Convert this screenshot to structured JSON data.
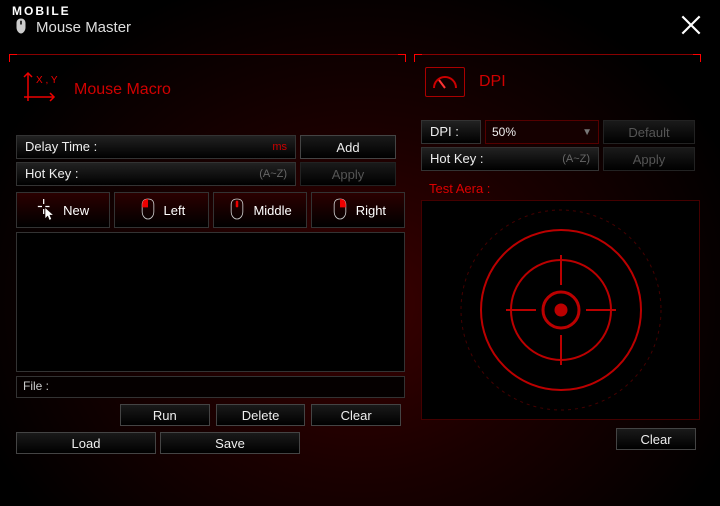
{
  "header": {
    "brand": "MOBILE",
    "title": "Mouse Master"
  },
  "macro": {
    "title": "Mouse Macro",
    "delay_label": "Delay Time :",
    "delay_unit": "ms",
    "add_label": "Add",
    "hotkey_label": "Hot Key :",
    "hotkey_hint": "(A~Z)",
    "apply_label": "Apply",
    "tabs": {
      "new": "New",
      "left": "Left",
      "middle": "Middle",
      "right": "Right"
    },
    "file_label": "File :",
    "run_label": "Run",
    "delete_label": "Delete",
    "clear_label": "Clear",
    "load_label": "Load",
    "save_label": "Save"
  },
  "dpi": {
    "title": "DPI",
    "dpi_label": "DPI :",
    "dpi_value": "50%",
    "default_label": "Default",
    "hotkey_label": "Hot Key :",
    "hotkey_hint": "(A~Z)",
    "apply_label": "Apply",
    "test_label": "Test Aera :",
    "clear_label": "Clear"
  }
}
